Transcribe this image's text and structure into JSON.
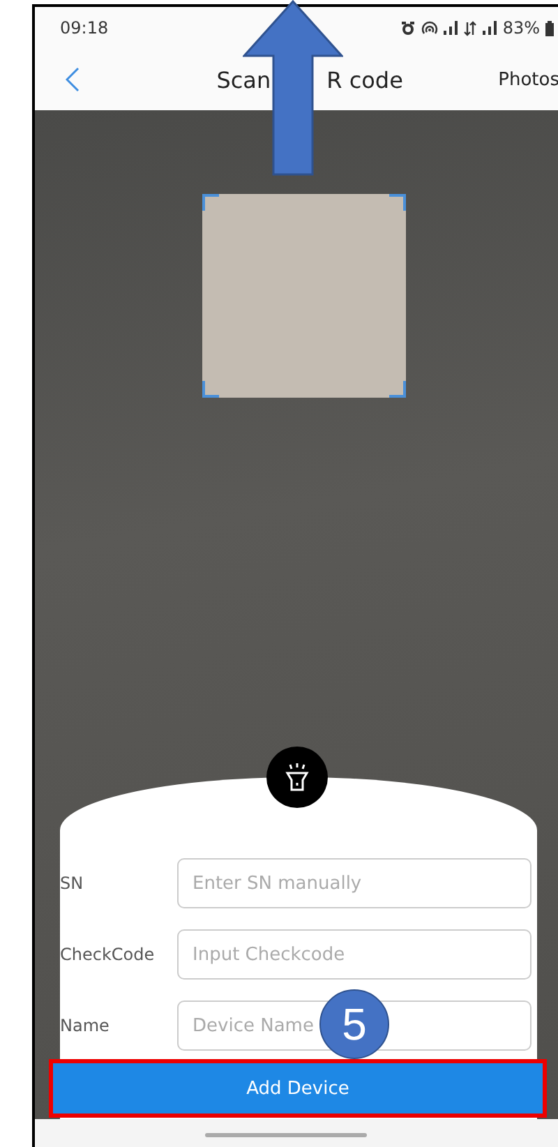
{
  "status_bar": {
    "time": "09:18",
    "battery": "83%"
  },
  "header": {
    "title_parts": [
      "Scan",
      "R code"
    ],
    "action": "Photos"
  },
  "form": {
    "fields": [
      {
        "label": "SN",
        "placeholder": "Enter SN manually"
      },
      {
        "label": "CheckCode",
        "placeholder": "Input Checkcode"
      },
      {
        "label": "Name",
        "placeholder": "Device Name"
      }
    ],
    "submit": "Add Device"
  },
  "annotation": {
    "step": "5"
  }
}
